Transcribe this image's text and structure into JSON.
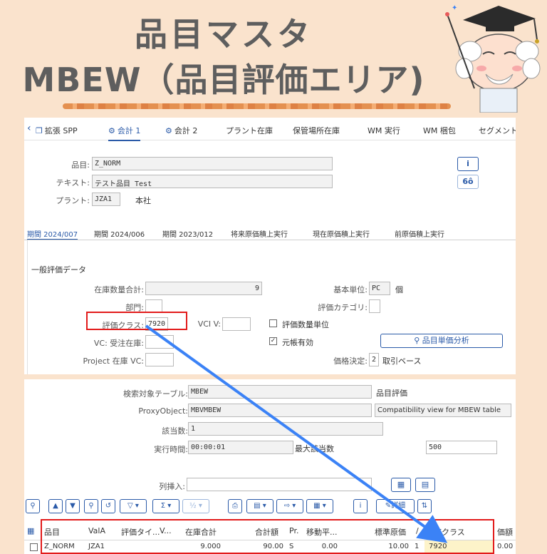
{
  "banner": {
    "line1": "品目マスタ",
    "line2": "MBEW（品目評価エリア)"
  },
  "panel1": {
    "tabs": [
      {
        "label": "拡張 SPP",
        "icon": "clipboard-icon"
      },
      {
        "label": "会計 1",
        "icon": "money-icon",
        "active": true
      },
      {
        "label": "会計 2",
        "icon": "money-icon"
      },
      {
        "label": "プラント在庫"
      },
      {
        "label": "保管場所在庫"
      },
      {
        "label": "WM 実行"
      },
      {
        "label": "WM 梱包"
      },
      {
        "label": "セグメント評"
      }
    ],
    "header": {
      "material_label": "品目:",
      "material_value": "Z_NORM",
      "text_label": "テキスト:",
      "text_value": "テスト品目_Test",
      "plant_label": "プラント:",
      "plant_value": "JZA1",
      "plant_name": "本社",
      "info_button": "i",
      "glasses_button": "6ô"
    },
    "subtabs": [
      {
        "label": "期間 2024/007",
        "active": true
      },
      {
        "label": "期間 2024/006"
      },
      {
        "label": "期間 2023/012"
      },
      {
        "label": "将来原価積上実行"
      },
      {
        "label": "現在原価積上実行"
      },
      {
        "label": "前原価積上実行"
      }
    ],
    "section_title": "一般評価データ",
    "fields": {
      "total_stock_label": "在庫数量合計:",
      "total_stock_value": "9",
      "base_unit_label": "基本単位:",
      "base_unit_value": "PC",
      "base_unit_text": "個",
      "division_label": "部門:",
      "division_value": "",
      "valuation_category_label": "評価カテゴリ:",
      "valuation_category_value": "",
      "valuation_class_label": "評価クラス:",
      "valuation_class_value": "7920",
      "vci_label": "VCI V:",
      "vci_value": "",
      "valuation_unit_label": "評価数量単位",
      "vc_sales_label": "VC: 受注在庫:",
      "vc_sales_value": "",
      "original_valid_label": "元帳有効",
      "analysis_button": "品目単価分析",
      "project_stock_label": "Project 在庫 VC:",
      "project_stock_value": "",
      "price_det_label": "価格決定:",
      "price_det_value": "2",
      "price_det_text": "取引ベース"
    }
  },
  "panel2": {
    "table_label": "検索対象テーブル:",
    "table_value": "MBEW",
    "table_desc": "品目評価",
    "proxy_label": "ProxyObject:",
    "proxy_value": "MBVMBEW",
    "proxy_desc": "Compatibility view for MBEW table",
    "count_label": "該当数:",
    "count_value": "1",
    "runtime_label": "実行時間:",
    "runtime_value": "00:00:01",
    "maxhits_label": "最大該当数",
    "maxhits_value": "500",
    "insert_col_label": "列挿入:",
    "insert_col_value": "",
    "toolbar_detail": "詳細",
    "columns": [
      "品目",
      "ValA",
      "評価タイ...",
      "V...",
      "在庫合計",
      "合計額",
      "Pr.",
      "移動平...",
      "標準原価",
      "/",
      "評価クラス",
      "価額"
    ],
    "row": {
      "material": "Z_NORM",
      "vala": "JZA1",
      "valtype": "",
      "v": "",
      "total_stock": "9.000",
      "total_value": "90.00",
      "price_ctrl": "S",
      "moving_avg": "0.00",
      "std_price": "10.00",
      "per": "1",
      "val_class": "7920",
      "value": "0.00"
    }
  },
  "colors": {
    "background": "#fae3cd",
    "accent": "#2a5aa8",
    "highlight_box": "#e21b1b",
    "arrow": "#3b82f6"
  }
}
